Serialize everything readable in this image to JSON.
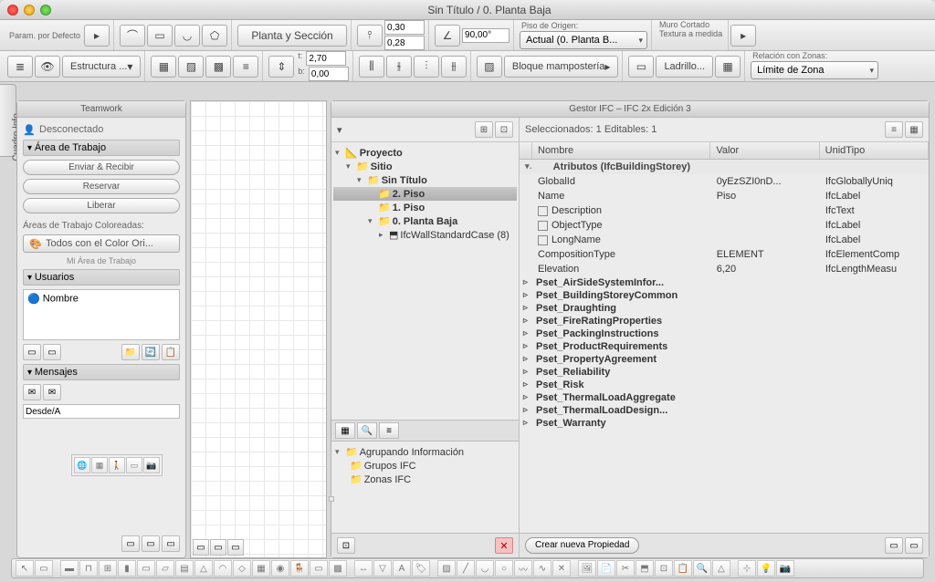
{
  "window": {
    "title": "Sin Título / 0. Planta Baja"
  },
  "toolbar1": {
    "param_label": "Param. por Defecto",
    "planta_btn": "Planta y Sección",
    "val_top": "0,30",
    "val_bot": "0,28",
    "angle": "90,00°",
    "piso_label": "Piso de Origen:",
    "piso_value": "Actual (0. Planta B...",
    "muro_label": "Muro Cortado",
    "textura_label": "Textura a medida"
  },
  "toolbar2": {
    "estructura_btn": "Estructura ...",
    "t_label": "t:",
    "b_label": "b:",
    "t_val": "2,70",
    "b_val": "0,00",
    "bloque_btn": "Bloque mampostería",
    "ladrillo_btn": "Ladrillo...",
    "relacion_label": "Relación con Zonas:",
    "limite_value": "Límite de Zona"
  },
  "side_tab": "Cuadro Info",
  "teamwork": {
    "title": "Teamwork",
    "status": "Desconectado",
    "area_head": "Área de Trabajo",
    "enviar_btn": "Enviar & Recibir",
    "reservar_btn": "Reservar",
    "liberar_btn": "Liberar",
    "coloreadas_label": "Áreas de Trabajo Coloreadas:",
    "todos_btn": "Todos con el Color Ori...",
    "mi_area": "Mi Área de Trabajo",
    "usuarios_head": "Usuarios",
    "nombre": "Nombre",
    "mensajes_head": "Mensajes",
    "desde": "Desde/A"
  },
  "ifc": {
    "title": "Gestor IFC – IFC 2x Edición 3",
    "sel_label": "Seleccionados:  1    Editables:  1",
    "tree": {
      "proyecto": "Proyecto",
      "sitio": "Sitio",
      "sin_titulo": "Sin Título",
      "piso2": "2. Piso",
      "piso1": "1. Piso",
      "planta_baja": "0. Planta Baja",
      "wall": "IfcWallStandardCase (8)"
    },
    "group": {
      "agrupando": "Agrupando Información",
      "grupos": "Grupos IFC",
      "zonas": "Zonas IFC"
    },
    "cols": {
      "nombre": "Nombre",
      "valor": "Valor",
      "unid": "UnidTipo"
    },
    "attrs_title": "Atributos (IfcBuildingStorey)",
    "rows": [
      {
        "n": "GlobalId",
        "v": "0yEzSZI0nD...",
        "t": "IfcGloballyUniq"
      },
      {
        "n": "Name",
        "v": "Piso",
        "t": "IfcLabel"
      },
      {
        "n": "Description",
        "v": "",
        "t": "IfcText",
        "chk": true
      },
      {
        "n": "ObjectType",
        "v": "",
        "t": "IfcLabel",
        "chk": true
      },
      {
        "n": "LongName",
        "v": "",
        "t": "IfcLabel",
        "chk": true
      },
      {
        "n": "CompositionType",
        "v": "ELEMENT",
        "t": "IfcElementComp"
      },
      {
        "n": "Elevation",
        "v": "6,20",
        "t": "IfcLengthMeasu"
      }
    ],
    "psets": [
      "Pset_AirSideSystemInfor...",
      "Pset_BuildingStoreyCommon",
      "Pset_Draughting",
      "Pset_FireRatingProperties",
      "Pset_PackingInstructions",
      "Pset_ProductRequirements",
      "Pset_PropertyAgreement",
      "Pset_Reliability",
      "Pset_Risk",
      "Pset_ThermalLoadAggregate",
      "Pset_ThermalLoadDesign...",
      "Pset_Warranty"
    ],
    "crear_btn": "Crear nueva Propiedad"
  }
}
